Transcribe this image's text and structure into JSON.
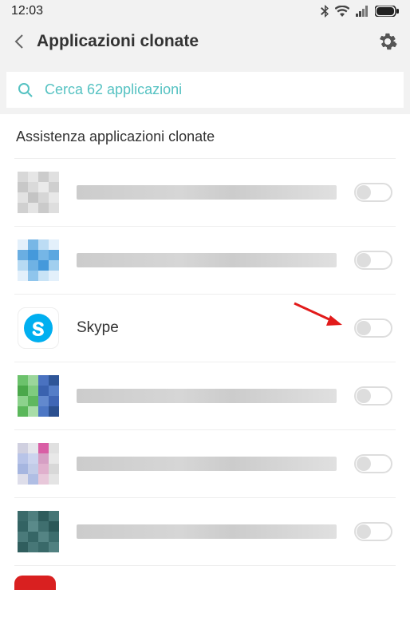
{
  "status": {
    "time": "12:03"
  },
  "header": {
    "title": "Applicazioni clonate"
  },
  "search": {
    "placeholder": "Cerca 62 applicazioni"
  },
  "section": {
    "title": "Assistenza applicazioni clonate"
  },
  "apps": [
    {
      "name": "",
      "redacted": true,
      "toggle": false
    },
    {
      "name": "",
      "redacted": true,
      "toggle": false
    },
    {
      "name": "Skype",
      "redacted": false,
      "toggle": false,
      "highlighted": true
    },
    {
      "name": "",
      "redacted": true,
      "toggle": false
    },
    {
      "name": "",
      "redacted": true,
      "toggle": false
    },
    {
      "name": "",
      "redacted": true,
      "toggle": false
    }
  ]
}
